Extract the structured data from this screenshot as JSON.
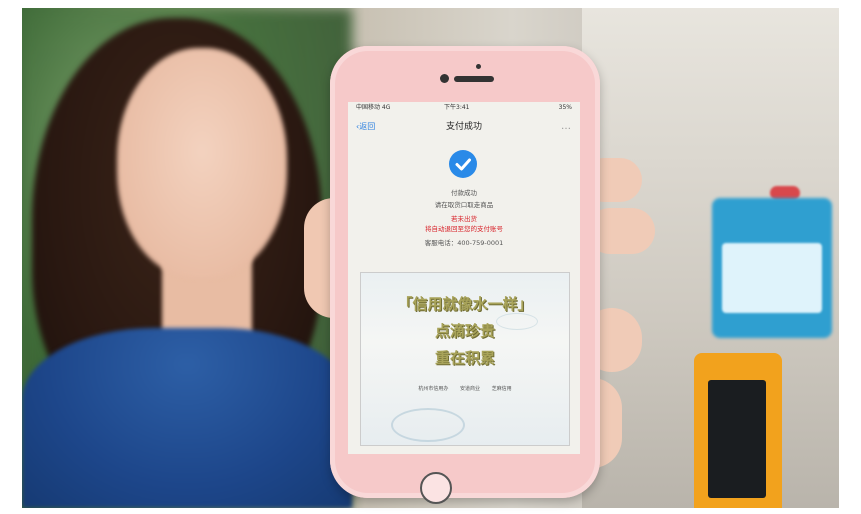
{
  "scene": {
    "description_colors": {
      "phone_case": "#f6c9c9",
      "accent_blue": "#2a8ae8",
      "warning_red": "#d8232a",
      "poster_gold": "#a8a35a",
      "kiosk_blue": "#2f9fd0",
      "kiosk_orange": "#f2a21d"
    }
  },
  "phone": {
    "status": {
      "carrier": "中国移动 4G",
      "time": "下午3:41",
      "battery": "35%"
    },
    "navbar": {
      "back_label": "返回",
      "title": "支付成功",
      "more": "…"
    },
    "icons": {
      "back": "chevron-left-icon",
      "success": "check-circle-icon"
    },
    "messages": {
      "line1": "付款成功",
      "line2": "请在取货口取走商品",
      "line3": "若未出货",
      "line4": "将自动退回至您的支付账号",
      "line5": "客服电话：400-759-0001"
    },
    "poster": {
      "line1": "「信用就像水一样」",
      "line2": "点滴珍贵",
      "line3": "重在积累",
      "logos": [
        "杭州市信用办",
        "安道商业",
        "芝麻信用"
      ]
    }
  }
}
